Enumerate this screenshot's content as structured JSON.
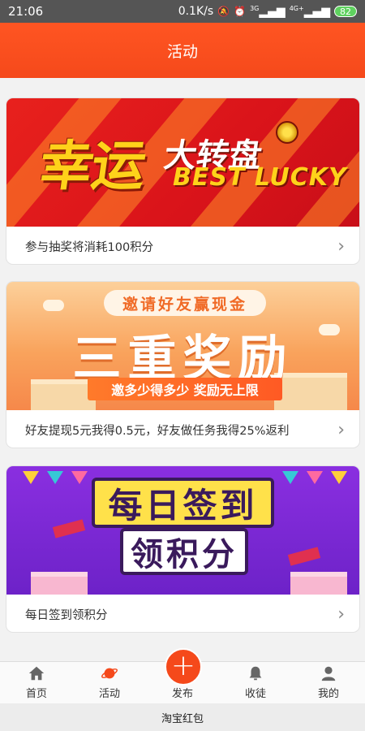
{
  "status_bar": {
    "time": "21:06",
    "speed": "0.1K/s",
    "net1": "3G",
    "net2": "4G+",
    "battery": "82"
  },
  "header": {
    "title": "活动"
  },
  "cards": [
    {
      "banner": {
        "main": "幸运",
        "main2": "大转盘",
        "sub": "BEST LUCKY"
      },
      "caption": "参与抽奖将消耗100积分"
    },
    {
      "banner": {
        "pill": "邀请好友赢现金",
        "main": "三重奖励",
        "sub": "邀多少得多少 奖励无上限"
      },
      "caption": "好友提现5元我得0.5元，好友做任务我得25%返利"
    },
    {
      "banner": {
        "main": "每日签到",
        "main2": "领积分"
      },
      "caption": "每日签到领积分"
    }
  ],
  "tabbar": {
    "items": [
      {
        "label": "首页",
        "icon": "home-icon"
      },
      {
        "label": "活动",
        "icon": "planet-icon"
      },
      {
        "label": "发布",
        "icon": "plus-icon"
      },
      {
        "label": "收徒",
        "icon": "bell-icon"
      },
      {
        "label": "我的",
        "icon": "user-icon"
      }
    ]
  },
  "footer": {
    "app_name": "淘宝红包"
  },
  "colors": {
    "accent": "#f5491b",
    "status_bar": "#555555"
  }
}
